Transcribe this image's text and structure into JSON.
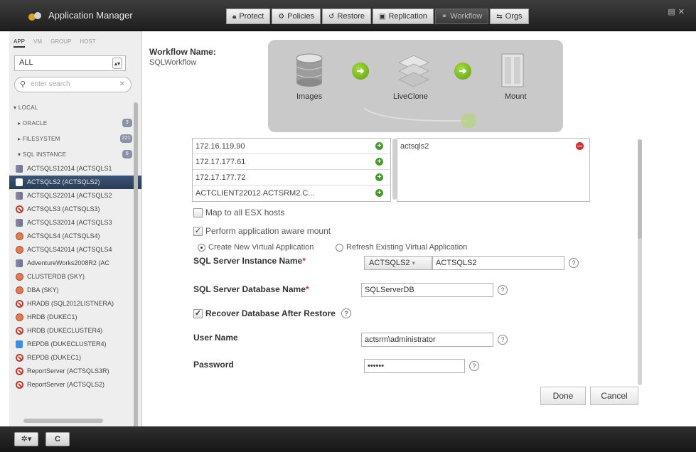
{
  "app": {
    "title": "Application Manager"
  },
  "nav": {
    "tabs": [
      {
        "label": "Protect",
        "icon": "lock-icon"
      },
      {
        "label": "Policies",
        "icon": "gear-icon"
      },
      {
        "label": "Restore",
        "icon": "restore-icon"
      },
      {
        "label": "Replication",
        "icon": "replication-icon"
      },
      {
        "label": "Workflow",
        "icon": "workflow-icon",
        "active": true
      },
      {
        "label": "Orgs",
        "icon": "orgs-icon"
      }
    ]
  },
  "sidebar": {
    "tabs": [
      "APP",
      "VM",
      "GROUP",
      "HOST"
    ],
    "filter": {
      "value": "ALL"
    },
    "search": {
      "placeholder": "enter search"
    },
    "tree": {
      "local": "LOCAL",
      "oracle": {
        "label": "ORACLE",
        "count": "3"
      },
      "filesystem": {
        "label": "FILESYSTEM",
        "count": "221"
      },
      "sql_instance": {
        "label": "SQL INSTANCE",
        "count": "6"
      }
    },
    "items": [
      {
        "label": "ACTSQLS12014 (ACTSQLS1",
        "icon": "db"
      },
      {
        "label": "ACTSQLS2 (ACTSQLS2)",
        "icon": "dbsel",
        "selected": true
      },
      {
        "label": "ACTSQLS22014 (ACTSQLS2",
        "icon": "db"
      },
      {
        "label": "ACTSQLS3 (ACTSQLS3)",
        "icon": "no"
      },
      {
        "label": "ACTSQLS32014 (ACTSQLS3",
        "icon": "db"
      },
      {
        "label": "ACTSQLS4 (ACTSQLS4)",
        "icon": "hr"
      },
      {
        "label": "ACTSQLS42014 (ACTSQLS4",
        "icon": "hr"
      },
      {
        "label": "AdventureWorks2008R2 (AC",
        "icon": "db"
      },
      {
        "label": "CLUSTERDB (SKY)",
        "icon": "hr"
      },
      {
        "label": "DBA (SKY)",
        "icon": "hr"
      },
      {
        "label": "HRADB (SQL2012LISTNERA)",
        "icon": "no"
      },
      {
        "label": "HRDB (DUKEC1)",
        "icon": "hr"
      },
      {
        "label": "HRDB (DUKECLUSTER4)",
        "icon": "no"
      },
      {
        "label": "REPDB (DUKECLUSTER4)",
        "icon": "ok"
      },
      {
        "label": "REPDB (DUKEC1)",
        "icon": "no"
      },
      {
        "label": "ReportServer (ACTSQLS3R)",
        "icon": "no"
      },
      {
        "label": "ReportServer (ACTSQLS2)",
        "icon": "no"
      }
    ]
  },
  "bottom": {
    "gear": "✲▾",
    "refresh": "C"
  },
  "workflow": {
    "name_label": "Workflow Name:",
    "name_value": "SQLWorkflow"
  },
  "diagram": {
    "images": "Images",
    "liveclone": "LiveClone",
    "mount": "Mount"
  },
  "hosts": {
    "available": [
      "172.16.119.90",
      "172.17.177.61",
      "172.17.177.72",
      "ACTCLIENT22012.ACTSRM2.C..."
    ],
    "selected": [
      "actsqls2"
    ]
  },
  "options": {
    "map_all_esx": "Map to all ESX hosts",
    "app_aware": "Perform application aware mount",
    "create_new": "Create New Virtual Application",
    "refresh_existing": "Refresh Existing Virtual Application",
    "recover_db": "Recover Database After Restore"
  },
  "form": {
    "instance_label": "SQL Server Instance Name",
    "instance_select": "ACTSQLS2",
    "instance_value": "ACTSQLS2",
    "db_label": "SQL Server Database Name",
    "db_value": "SQLServerDB",
    "user_label": "User Name",
    "user_value": "actsrm\\administrator",
    "password_label": "Password",
    "password_value": "••••••",
    "required": "*",
    "help": "?"
  },
  "buttons": {
    "done": "Done",
    "cancel": "Cancel"
  }
}
